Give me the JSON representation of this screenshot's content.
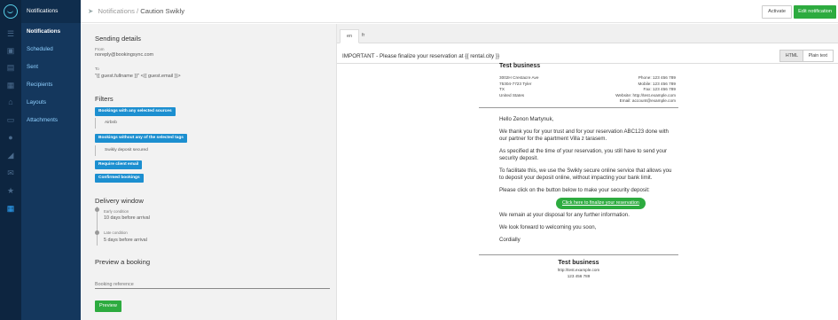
{
  "nav": {
    "header": "Notifications",
    "items": [
      {
        "label": "Notifications",
        "active": true
      },
      {
        "label": "Scheduled",
        "active": false
      },
      {
        "label": "Sent",
        "active": false
      },
      {
        "label": "Recipients",
        "active": false
      },
      {
        "label": "Layouts",
        "active": false
      },
      {
        "label": "Attachments",
        "active": false
      }
    ]
  },
  "rail_icons": [
    "menu-icon",
    "inbox-icon",
    "list-icon",
    "calendar-icon",
    "home-icon",
    "card-icon",
    "tag-icon",
    "envelope-icon",
    "star-icon",
    "grid-icon"
  ],
  "topbar": {
    "breadcrumb_root": "Notifications",
    "breadcrumb_sep": "/",
    "breadcrumb_current": "Caution Swikly",
    "activate_label": "Activate",
    "edit_label": "Edit notification"
  },
  "sending": {
    "title": "Sending details",
    "from_label": "From",
    "from_value": "noreply@bookingsync.com",
    "to_label": "To",
    "to_value": "\"{{ guest.fullname }}\" <{{ guest.email }}>"
  },
  "filters": {
    "title": "Filters",
    "chip1": "Bookings with any selected sources",
    "chip1_sub": "Airbnb",
    "chip2": "Bookings without any of the selected tags",
    "chip2_sub": "Swikly deposit secured",
    "chip3": "Require client email",
    "chip4": "Confirmed bookings"
  },
  "delivery": {
    "title": "Delivery window",
    "early_label": "Early condition",
    "early_value": "10 days before arrival",
    "late_label": "Late condition",
    "late_value": "5 days before arrival"
  },
  "preview": {
    "title": "Preview a booking",
    "input_placeholder": "Booking reference",
    "button_label": "Preview"
  },
  "tabs": [
    "en",
    "fr"
  ],
  "subject": "IMPORTANT - Please finalize your reservation at {{ rental.city }}",
  "format_buttons": {
    "html": "HTML",
    "plain": "Plain text"
  },
  "email": {
    "business_name": "Test business",
    "address": [
      "3002H Crestacre Ave",
      "75304-7723 Tyler",
      "TX",
      "United States"
    ],
    "contacts": [
      "Phone: 123 456 789",
      "Mobile: 123 456 789",
      "Fax: 123 456 789",
      "Website: http://test.example.com",
      "Email: account@example.com"
    ],
    "greeting": "Hello Zenon Martynuk,",
    "p1": "We thank you for your trust and for your reservation ABC123 done with our partner for the apartment Villa z tarasem.",
    "p2": "As specified at the time of your reservation, you still have to send your security deposit.",
    "p3": "To facilitate this, we use the Swikly secure online service that allows you to deposit your deposit online, without impacting your bank limit.",
    "p4": "Please click on the button below to make your security deposit:",
    "cta": "Click here to finalize your reservation",
    "p5": "We remain at your disposal for any further information.",
    "p6": "We look forward to welcoming you soon,",
    "p7": "Cordially",
    "footer_name": "Test business",
    "footer_site": "http://test.example.com",
    "footer_phone": "123 456 789"
  }
}
